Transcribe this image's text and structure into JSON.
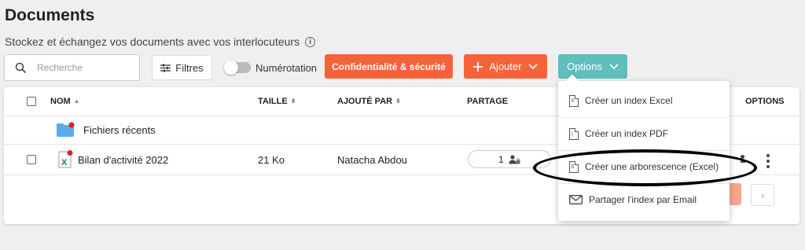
{
  "page": {
    "title": "Documents",
    "subtitle": "Stockez et échangez vos documents avec vos interlocuteurs",
    "info_icon": "i"
  },
  "toolbar": {
    "search_placeholder": "Recherche",
    "filters_label": "Filtres",
    "numerotation_label": "Numérotation",
    "numerotation_enabled": false,
    "confidentiality_label": "Confidentialité & sécurité",
    "add_label": "Ajouter",
    "options_label": "Options"
  },
  "table": {
    "columns": {
      "name": "NOM",
      "size": "TAILLE",
      "added_by": "AJOUTÉ PAR",
      "sharing": "PARTAGE",
      "options": "OPTIONS"
    },
    "rows": [
      {
        "type": "folder",
        "name": "Fichiers récents"
      },
      {
        "type": "excel",
        "name": "Bilan d'activité 2022",
        "size": "21 Ko",
        "added_by": "Natacha Abdou",
        "share_count": "1"
      }
    ],
    "next_page": "›"
  },
  "options_menu": {
    "items": [
      {
        "label": "Créer un index Excel",
        "icon": "excel-file-icon"
      },
      {
        "label": "Créer un index PDF",
        "icon": "pdf-file-icon"
      },
      {
        "label": "Créer une arborescence (Excel)",
        "icon": "excel-file-icon"
      },
      {
        "label": "Partager l'index par Email",
        "icon": "envelope-icon"
      }
    ]
  },
  "colors": {
    "accent_orange": "#f4633a",
    "options_teal": "#5ebfbd",
    "folder_blue": "#5aabee",
    "excel_green": "#1e7b45"
  }
}
